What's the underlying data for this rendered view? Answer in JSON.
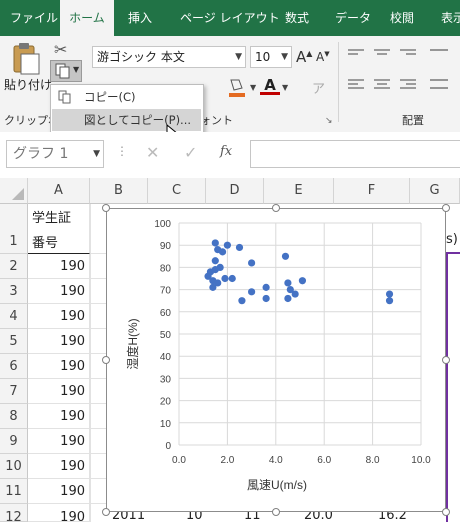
{
  "ribbon_tabs": [
    "ファイル",
    "ホーム",
    "挿入",
    "ページ レイアウト",
    "数式",
    "データ",
    "校閲",
    "表示"
  ],
  "active_tab": "ホーム",
  "clipboard": {
    "paste_label": "貼り付け",
    "group_label": "クリップボ"
  },
  "font": {
    "name": "游ゴシック 本文",
    "size": "10",
    "group_label": "ォント"
  },
  "alignment": {
    "group_label": "配置"
  },
  "copy_menu": {
    "copy": "コピー(C)",
    "copy_as_picture": "図としてコピー(P)..."
  },
  "name_box": "グラフ 1",
  "formula_fx": "fx",
  "columns": [
    "A",
    "B",
    "C",
    "D",
    "E",
    "F",
    "G"
  ],
  "rows": [
    "1",
    "2",
    "3",
    "4",
    "5",
    "6",
    "7",
    "8",
    "9",
    "10",
    "11",
    "12"
  ],
  "col_a": {
    "header_line1": "学生証",
    "header_line2": "番号",
    "values": [
      "190",
      "190",
      "190",
      "190",
      "190",
      "190",
      "190",
      "190",
      "190",
      "190",
      "190"
    ]
  },
  "row12": {
    "b": "2011",
    "c": "10",
    "d": "11",
    "e": "20.0",
    "f": "16.2"
  },
  "g_partial": "s)",
  "colors": {
    "excel_green": "#217346",
    "series": "#4472c4",
    "purple_border": "#7030a0"
  },
  "chart_data": {
    "type": "scatter",
    "xlabel": "風速U(m/s)",
    "ylabel": "湿度H(%)",
    "xlim": [
      0,
      10
    ],
    "ylim": [
      0,
      100
    ],
    "xticks": [
      "0.0",
      "2.0",
      "4.0",
      "6.0",
      "8.0",
      "10.0"
    ],
    "yticks": [
      "0",
      "10",
      "20",
      "30",
      "40",
      "50",
      "60",
      "70",
      "80",
      "90",
      "100"
    ],
    "grid": true,
    "points": [
      [
        1.5,
        91
      ],
      [
        1.6,
        88
      ],
      [
        1.8,
        87
      ],
      [
        1.5,
        83
      ],
      [
        2.0,
        90
      ],
      [
        2.5,
        89
      ],
      [
        1.3,
        78
      ],
      [
        1.5,
        79
      ],
      [
        1.7,
        80
      ],
      [
        1.2,
        76
      ],
      [
        1.4,
        74
      ],
      [
        1.9,
        75
      ],
      [
        1.6,
        73
      ],
      [
        2.2,
        75
      ],
      [
        1.4,
        71
      ],
      [
        3.0,
        82
      ],
      [
        4.4,
        85
      ],
      [
        4.5,
        73
      ],
      [
        5.1,
        74
      ],
      [
        3.6,
        71
      ],
      [
        4.8,
        68
      ],
      [
        3.0,
        69
      ],
      [
        4.6,
        70
      ],
      [
        2.6,
        65
      ],
      [
        3.6,
        66
      ],
      [
        4.5,
        66
      ],
      [
        8.7,
        68
      ],
      [
        8.7,
        65
      ]
    ]
  }
}
